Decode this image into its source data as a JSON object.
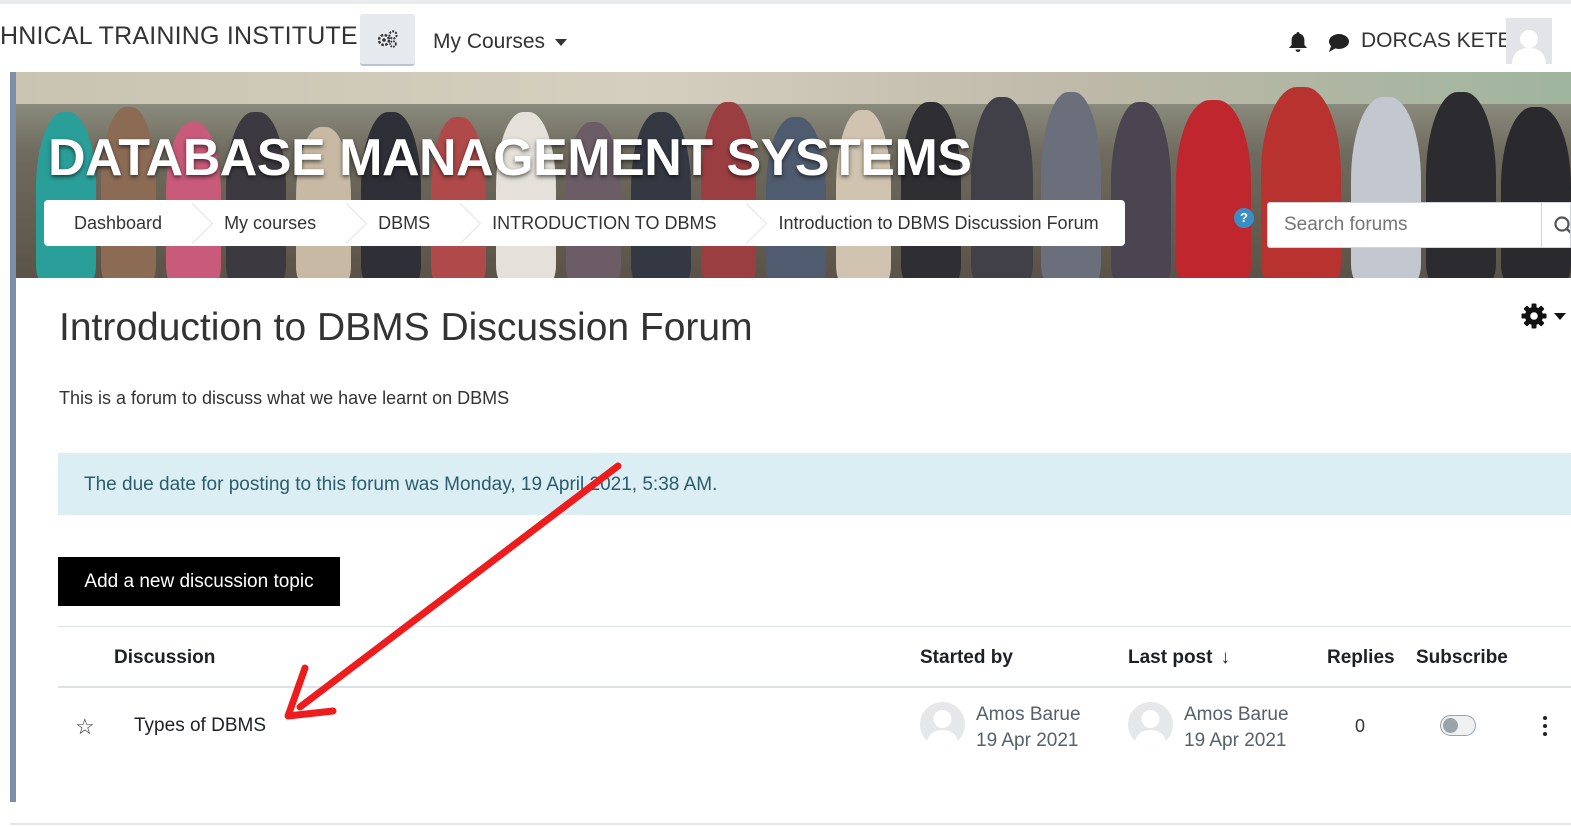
{
  "navbar": {
    "brand": "HNICAL TRAINING INSTITUTE",
    "nav_drawer_icon": "gears-icon",
    "my_courses": "My Courses",
    "user_name": "DORCAS KETER"
  },
  "header": {
    "course_title": "DATABASE MANAGEMENT SYSTEMS",
    "breadcrumb": [
      "Dashboard",
      "My courses",
      "DBMS",
      "INTRODUCTION TO DBMS",
      "Introduction to DBMS Discussion Forum"
    ],
    "help_badge": "?",
    "search_placeholder": "Search forums"
  },
  "main": {
    "title": "Introduction to DBMS Discussion Forum",
    "intro": "This is a forum to discuss what we have learnt on DBMS",
    "due_notice": "The due date for posting to this forum was Monday, 19 April 2021, 5:38 AM.",
    "add_topic_button": "Add a new discussion topic"
  },
  "discussion_table": {
    "headers": {
      "discussion": "Discussion",
      "started_by": "Started by",
      "last_post": "Last post",
      "last_post_sort": "↓",
      "replies": "Replies",
      "subscribe": "Subscribe"
    },
    "rows": [
      {
        "starred": false,
        "topic": "Types of DBMS",
        "started_by_name": "Amos Barue",
        "started_by_date": "19 Apr 2021",
        "last_post_name": "Amos Barue",
        "last_post_date": "19 Apr 2021",
        "replies": "0",
        "subscribed": false
      }
    ]
  },
  "annotation": {
    "arrow_color": "#ee1c1c"
  }
}
